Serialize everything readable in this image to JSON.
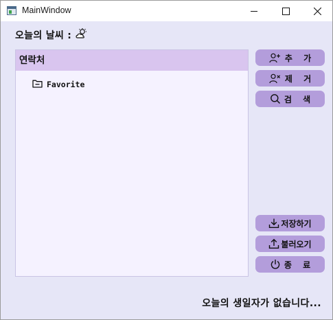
{
  "window": {
    "title": "MainWindow"
  },
  "weather": {
    "label": "오늘의 날씨 :",
    "icon": "partly-cloudy-icon"
  },
  "contacts": {
    "header": "연락처",
    "items": [
      {
        "label": "Favorite",
        "icon": "folder-icon"
      }
    ]
  },
  "actions": {
    "add": {
      "label": "추 가",
      "icon": "person-add-icon"
    },
    "remove": {
      "label": "제 거",
      "icon": "person-remove-icon"
    },
    "search": {
      "label": "검 색",
      "icon": "search-icon"
    },
    "save": {
      "label": "저장하기",
      "icon": "download-icon"
    },
    "load": {
      "label": "불러오기",
      "icon": "upload-icon"
    },
    "exit": {
      "label": "종 료",
      "icon": "power-icon"
    }
  },
  "status": {
    "birthday_message": "오늘의 생일자가 없습니다..."
  },
  "colors": {
    "background": "#e6e6f7",
    "button": "#b39ddb",
    "header": "#d9c5ef",
    "panel": "#f5f2ff"
  }
}
